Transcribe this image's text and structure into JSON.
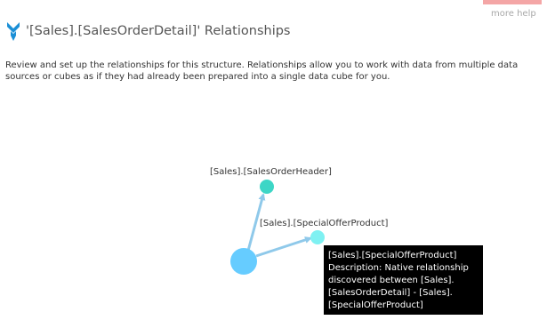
{
  "header": {
    "more_help_label": "more help",
    "title": "'[Sales].[SalesOrderDetail]' Relationships",
    "title_icon": "funnel-arrow-icon"
  },
  "description": "Review and set up the relationships for this structure. Relationships allow you to work with data from multiple data sources or cubes as if they had already been prepared into a single data cube for you.",
  "graph": {
    "nodes": [
      {
        "id": "center",
        "label": "",
        "color": "#66ccff"
      },
      {
        "id": "sales-order-header",
        "label": "[Sales].[SalesOrderHeader]",
        "color": "#3dd6c6"
      },
      {
        "id": "special-offer-product",
        "label": "[Sales].[SpecialOfferProduct]",
        "color": "#7ff1f2"
      }
    ],
    "edges": [
      {
        "from": "center",
        "to": "sales-order-header"
      },
      {
        "from": "center",
        "to": "special-offer-product"
      }
    ],
    "edge_color": "#8fc9ea"
  },
  "tooltip": {
    "lines": [
      "[Sales].[SpecialOfferProduct]",
      "Description: Native relationship",
      "discovered between [Sales].",
      "[SalesOrderDetail] - [Sales].",
      "[SpecialOfferProduct]"
    ]
  }
}
